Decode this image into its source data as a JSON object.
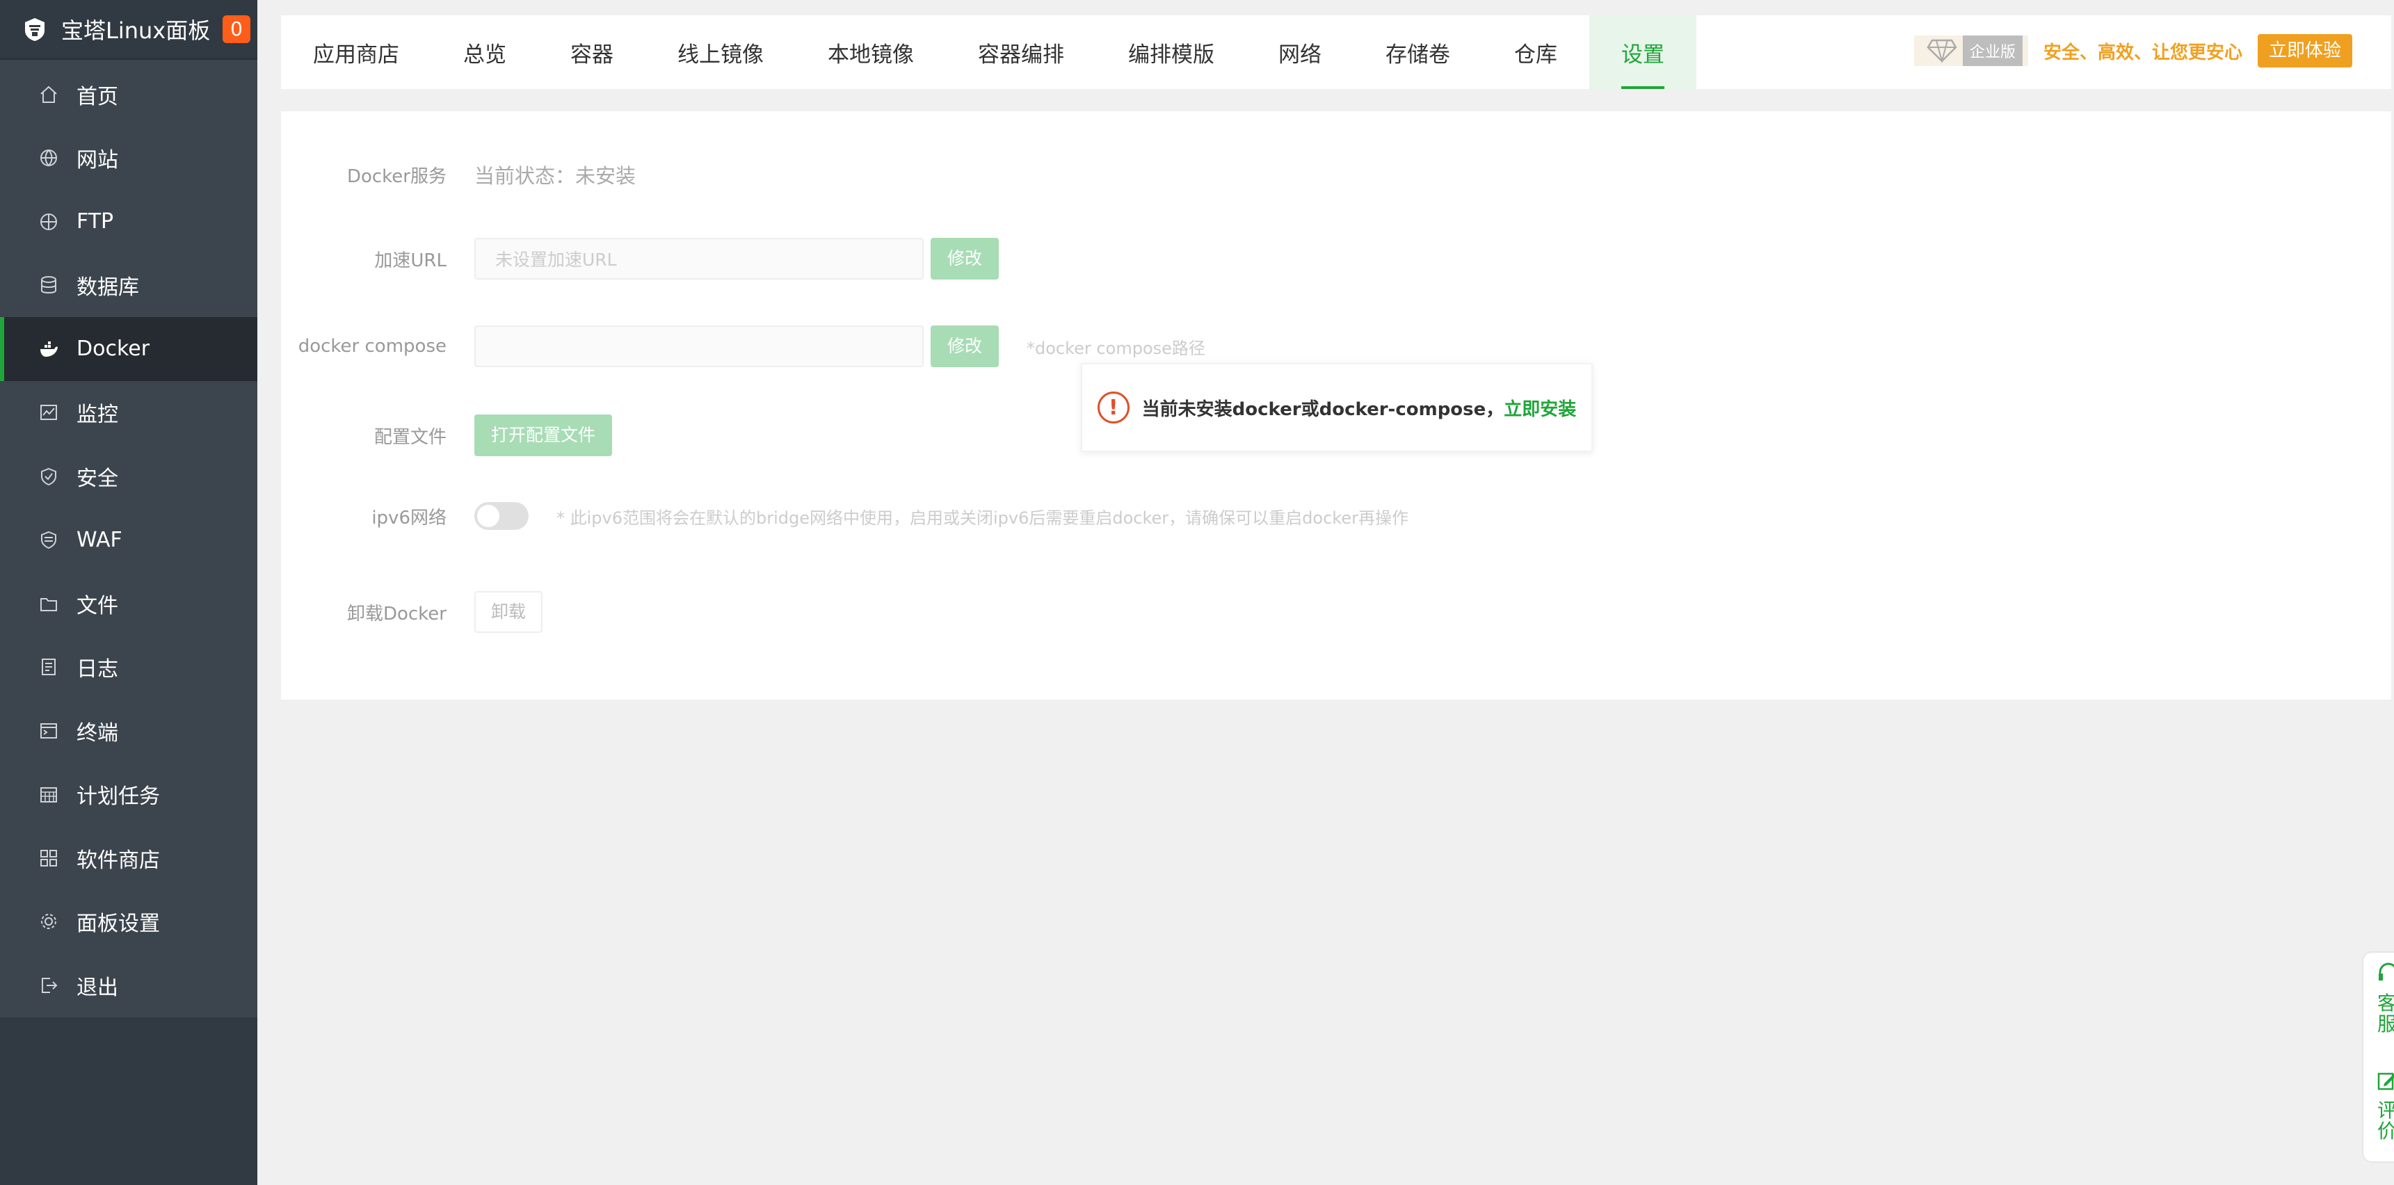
{
  "sidebar": {
    "brand": "宝塔Linux面板",
    "badge": "0",
    "items": [
      {
        "label": "首页",
        "icon": "home-icon"
      },
      {
        "label": "网站",
        "icon": "globe-icon"
      },
      {
        "label": "FTP",
        "icon": "ftp-globe-icon"
      },
      {
        "label": "数据库",
        "icon": "database-icon"
      },
      {
        "label": "Docker",
        "icon": "docker-icon"
      },
      {
        "label": "监控",
        "icon": "monitor-icon"
      },
      {
        "label": "安全",
        "icon": "shield-icon"
      },
      {
        "label": "WAF",
        "icon": "waf-shield-icon"
      },
      {
        "label": "文件",
        "icon": "folder-icon"
      },
      {
        "label": "日志",
        "icon": "log-icon"
      },
      {
        "label": "终端",
        "icon": "terminal-icon"
      },
      {
        "label": "计划任务",
        "icon": "calendar-icon"
      },
      {
        "label": "软件商店",
        "icon": "grid-icon"
      },
      {
        "label": "面板设置",
        "icon": "gear-icon"
      },
      {
        "label": "退出",
        "icon": "logout-icon"
      }
    ],
    "active_index": 4
  },
  "tabs": [
    "应用商店",
    "总览",
    "容器",
    "线上镜像",
    "本地镜像",
    "容器编排",
    "编排模版",
    "网络",
    "存储卷",
    "仓库",
    "设置"
  ],
  "active_tab": "设置",
  "ad": {
    "badge": "企业版",
    "text": "安全、高效、让您更安心",
    "button": "立即体验"
  },
  "settings": {
    "docker_service": {
      "label": "Docker服务",
      "value": "当前状态：未安装"
    },
    "mirror": {
      "label": "加速URL",
      "placeholder": "未设置加速URL",
      "button": "修改"
    },
    "compose": {
      "label": "docker compose",
      "value": "",
      "button": "修改",
      "hint": "*docker compose路径"
    },
    "config": {
      "label": "配置文件",
      "button": "打开配置文件"
    },
    "ipv6": {
      "label": "ipv6网络",
      "hint": "* 此ipv6范围将会在默认的bridge网络中使用，启用或关闭ipv6后需要重启docker，请确保可以重启docker再操作"
    },
    "uninstall": {
      "label": "卸载Docker",
      "button": "卸载"
    }
  },
  "notice": {
    "text": "当前未安装docker或docker-compose，",
    "link": "立即安装"
  },
  "float": {
    "service": "客服",
    "review": "评价"
  },
  "colors": {
    "accent": "#20a53a",
    "sidebar": "#313942",
    "warn": "#e0502a",
    "ad": "#f0a020"
  }
}
